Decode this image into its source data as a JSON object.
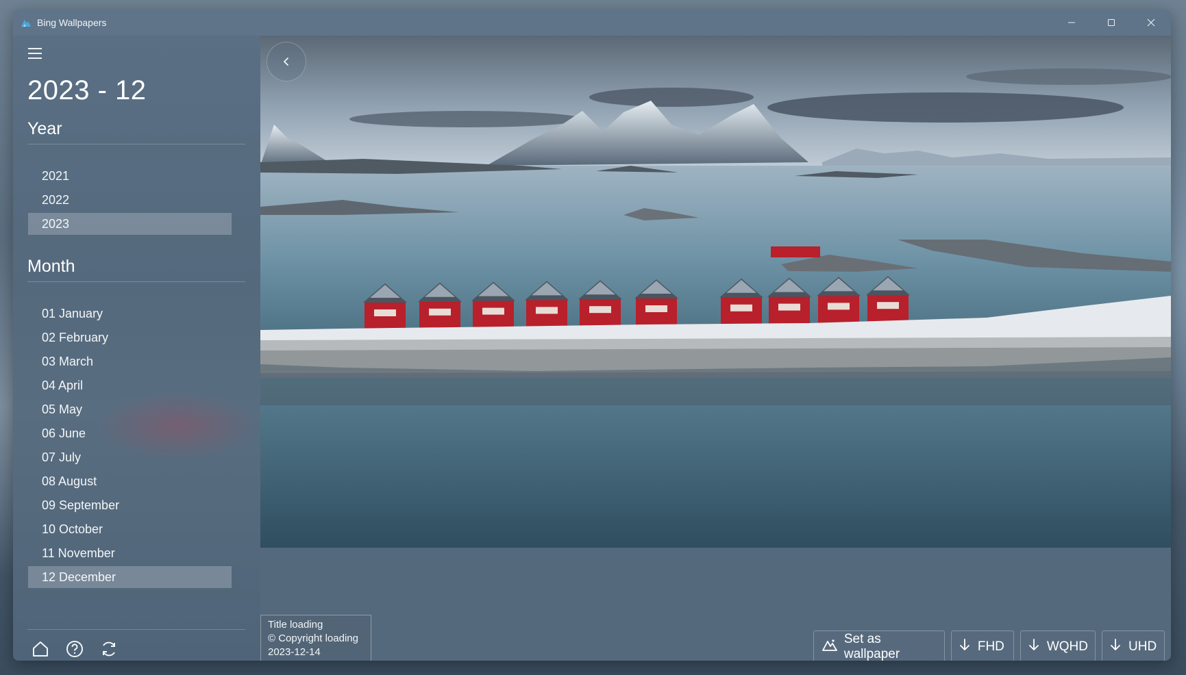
{
  "window": {
    "title": "Bing Wallpapers"
  },
  "sidebar": {
    "page_title": "2023 - 12",
    "year_header": "Year",
    "years": [
      {
        "label": "2021",
        "selected": false
      },
      {
        "label": "2022",
        "selected": false
      },
      {
        "label": "2023",
        "selected": true
      }
    ],
    "month_header": "Month",
    "months": [
      {
        "label": "01 January",
        "selected": false
      },
      {
        "label": "02 February",
        "selected": false
      },
      {
        "label": "03 March",
        "selected": false
      },
      {
        "label": "04 April",
        "selected": false
      },
      {
        "label": "05 May",
        "selected": false
      },
      {
        "label": "06 June",
        "selected": false
      },
      {
        "label": "07 July",
        "selected": false
      },
      {
        "label": "08 August",
        "selected": false
      },
      {
        "label": "09 September",
        "selected": false
      },
      {
        "label": "10 October",
        "selected": false
      },
      {
        "label": "11 November",
        "selected": false
      },
      {
        "label": "12 December",
        "selected": true
      }
    ],
    "footer_icons": [
      "home-icon",
      "help-icon",
      "refresh-icon"
    ]
  },
  "info": {
    "title": "Title loading",
    "copyright": "© Copyright loading",
    "date": "2023-12-14"
  },
  "actions": {
    "set_wallpaper": "Set as wallpaper",
    "fhd": "FHD",
    "wqhd": "WQHD",
    "uhd": "UHD"
  },
  "colors": {
    "accent_selected": "#7f92a5",
    "house_red": "#b8202b"
  }
}
